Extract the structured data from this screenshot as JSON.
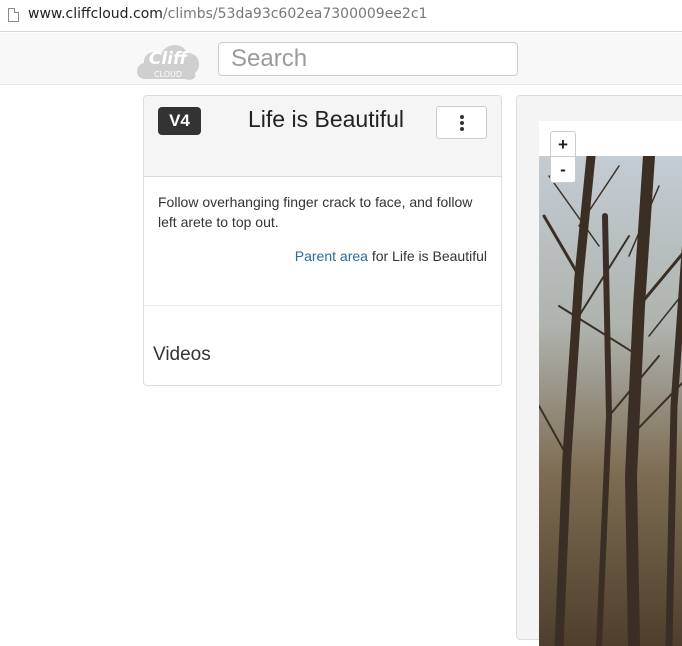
{
  "browser": {
    "url_host": "www.cliffcloud.com",
    "url_path": "/climbs/53da93c602ea7300009ee2c1"
  },
  "navbar": {
    "logo_text_1": "Cliff",
    "logo_text_2": "CLOUD",
    "search_placeholder": "Search"
  },
  "climb": {
    "grade": "V4",
    "title": "Life is Beautiful",
    "description": "Follow overhanging finger crack to face, and follow left arete to top out.",
    "parent_link_label": "Parent area",
    "parent_suffix": " for Life is Beautiful",
    "videos_label": "Videos"
  },
  "map": {
    "zoom_in": "+",
    "zoom_out": "-"
  },
  "icons": {
    "page": "page-icon",
    "menu": "vertical-ellipsis-icon",
    "logo": "cloud-logo-icon"
  }
}
